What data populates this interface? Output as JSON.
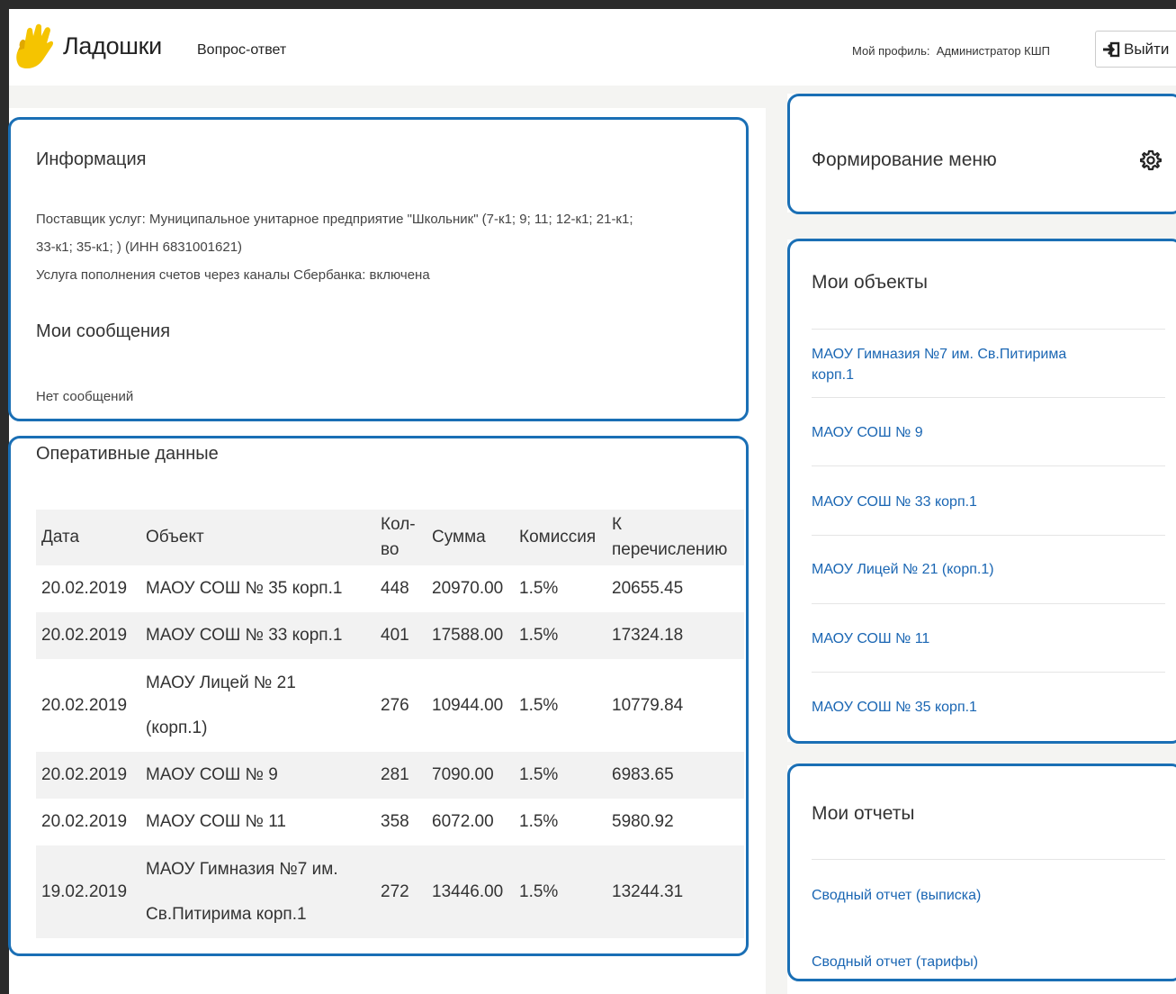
{
  "header": {
    "logo_text": "Ладошки",
    "nav_link": "Вопрос-ответ",
    "profile_label": "Мой профиль:",
    "profile_name": "Администратор КШП",
    "logout_label": "Выйти"
  },
  "info": {
    "title": "Информация",
    "line1": "Поставщик услуг: Муниципальное унитарное предприятие \"Школьник\" (7-к1; 9; 11; 12-к1; 21-к1;",
    "line2": "33-к1; 35-к1; ) (ИНН 6831001621)",
    "line3": "Услуга пополнения счетов через каналы Сбербанка: включена"
  },
  "messages": {
    "title": "Мои сообщения",
    "empty": "Нет сообщений"
  },
  "operational": {
    "title": "Оперативные данные",
    "columns": [
      "Дата",
      "Объект",
      "Кол-во",
      "Сумма",
      "Комиссия",
      "К перечислению"
    ],
    "rows": [
      {
        "date": "20.02.2019",
        "object": "МАОУ СОШ № 35 корп.1",
        "count": "448",
        "sum": "20970.00",
        "commission": "1.5%",
        "transfer": "20655.45"
      },
      {
        "date": "20.02.2019",
        "object": "МАОУ СОШ № 33 корп.1",
        "count": "401",
        "sum": "17588.00",
        "commission": "1.5%",
        "transfer": "17324.18"
      },
      {
        "date": "20.02.2019",
        "object": "МАОУ Лицей № 21 (корп.1)",
        "count": "276",
        "sum": "10944.00",
        "commission": "1.5%",
        "transfer": "10779.84"
      },
      {
        "date": "20.02.2019",
        "object": "МАОУ СОШ № 9",
        "count": "281",
        "sum": "7090.00",
        "commission": "1.5%",
        "transfer": "6983.65"
      },
      {
        "date": "20.02.2019",
        "object": "МАОУ СОШ № 11",
        "count": "358",
        "sum": "6072.00",
        "commission": "1.5%",
        "transfer": "5980.92"
      },
      {
        "date": "19.02.2019",
        "object": "МАОУ Гимназия №7 им. Св.Питирима корп.1",
        "count": "272",
        "sum": "13446.00",
        "commission": "1.5%",
        "transfer": "13244.31"
      }
    ]
  },
  "menu_card": {
    "title": "Формирование меню",
    "icon": "gear-icon"
  },
  "objects_card": {
    "title": "Мои объекты",
    "items": [
      "МАОУ Гимназия №7 им. Св.Питирима корп.1",
      "МАОУ СОШ № 9",
      "МАОУ СОШ № 33 корп.1",
      "МАОУ Лицей № 21 (корп.1)",
      "МАОУ СОШ № 11",
      "МАОУ СОШ № 35 корп.1"
    ]
  },
  "reports_card": {
    "title": "Мои отчеты",
    "items": [
      "Сводный отчет (выписка)",
      "Сводный отчет (тарифы)"
    ]
  },
  "colors": {
    "accent_link": "#1a66b3",
    "highlight_border": "#1a6fb5",
    "logo_yellow": "#f5c400"
  }
}
